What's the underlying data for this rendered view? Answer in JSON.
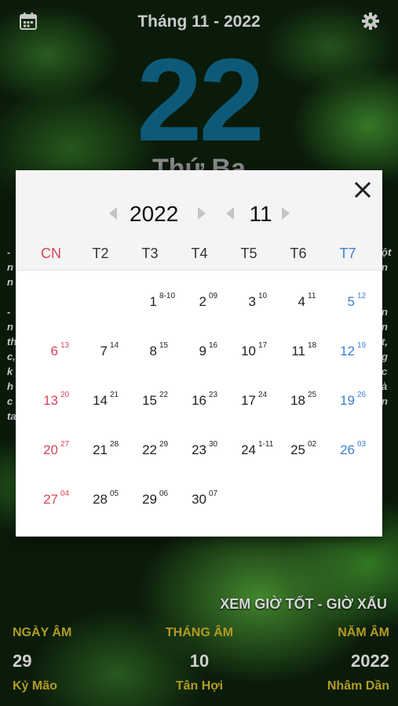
{
  "header": {
    "title": "Tháng 11 - 2022",
    "calendar_icon": "calendar-icon",
    "settings_icon": "gear-icon"
  },
  "today": {
    "day": "22",
    "weekday": "Thứ Ba"
  },
  "side_text": {
    "left": [
      "-",
      "n",
      "n",
      "",
      "-",
      "n",
      "th",
      "c,",
      "k",
      "h",
      "c",
      "ta"
    ],
    "right": [
      "ột",
      "n",
      "",
      "",
      "n",
      "n",
      "t,",
      "g",
      "c",
      "à",
      "n",
      ""
    ]
  },
  "good_bad_hours": "XEM GIỜ TỐT - GIỜ XẤU",
  "lunar": {
    "day": {
      "label": "NGÀY ÂM",
      "value": "29",
      "name": "Kỷ Mão"
    },
    "month": {
      "label": "THÁNG ÂM",
      "value": "10",
      "name": "Tân Hợi"
    },
    "year": {
      "label": "NĂM ÂM",
      "value": "2022",
      "name": "Nhâm Dần"
    }
  },
  "picker": {
    "year": "2022",
    "month": "11",
    "weekdays": [
      "CN",
      "T2",
      "T3",
      "T4",
      "T5",
      "T6",
      "T7"
    ],
    "colors": {
      "sunday": "#d9455a",
      "saturday": "#3f7fd1",
      "accent": "#0d5a78"
    },
    "first_weekday_index": 2,
    "days": [
      {
        "d": "1",
        "l": "8-10"
      },
      {
        "d": "2",
        "l": "09"
      },
      {
        "d": "3",
        "l": "10"
      },
      {
        "d": "4",
        "l": "11"
      },
      {
        "d": "5",
        "l": "12"
      },
      {
        "d": "6",
        "l": "13"
      },
      {
        "d": "7",
        "l": "14"
      },
      {
        "d": "8",
        "l": "15"
      },
      {
        "d": "9",
        "l": "16"
      },
      {
        "d": "10",
        "l": "17"
      },
      {
        "d": "11",
        "l": "18"
      },
      {
        "d": "12",
        "l": "19"
      },
      {
        "d": "13",
        "l": "20"
      },
      {
        "d": "14",
        "l": "21"
      },
      {
        "d": "15",
        "l": "22"
      },
      {
        "d": "16",
        "l": "23"
      },
      {
        "d": "17",
        "l": "24"
      },
      {
        "d": "18",
        "l": "25"
      },
      {
        "d": "19",
        "l": "26"
      },
      {
        "d": "20",
        "l": "27"
      },
      {
        "d": "21",
        "l": "28"
      },
      {
        "d": "22",
        "l": "29"
      },
      {
        "d": "23",
        "l": "30"
      },
      {
        "d": "24",
        "l": "1-11"
      },
      {
        "d": "25",
        "l": "02"
      },
      {
        "d": "26",
        "l": "03"
      },
      {
        "d": "27",
        "l": "04"
      },
      {
        "d": "28",
        "l": "05"
      },
      {
        "d": "29",
        "l": "06"
      },
      {
        "d": "30",
        "l": "07"
      }
    ]
  }
}
